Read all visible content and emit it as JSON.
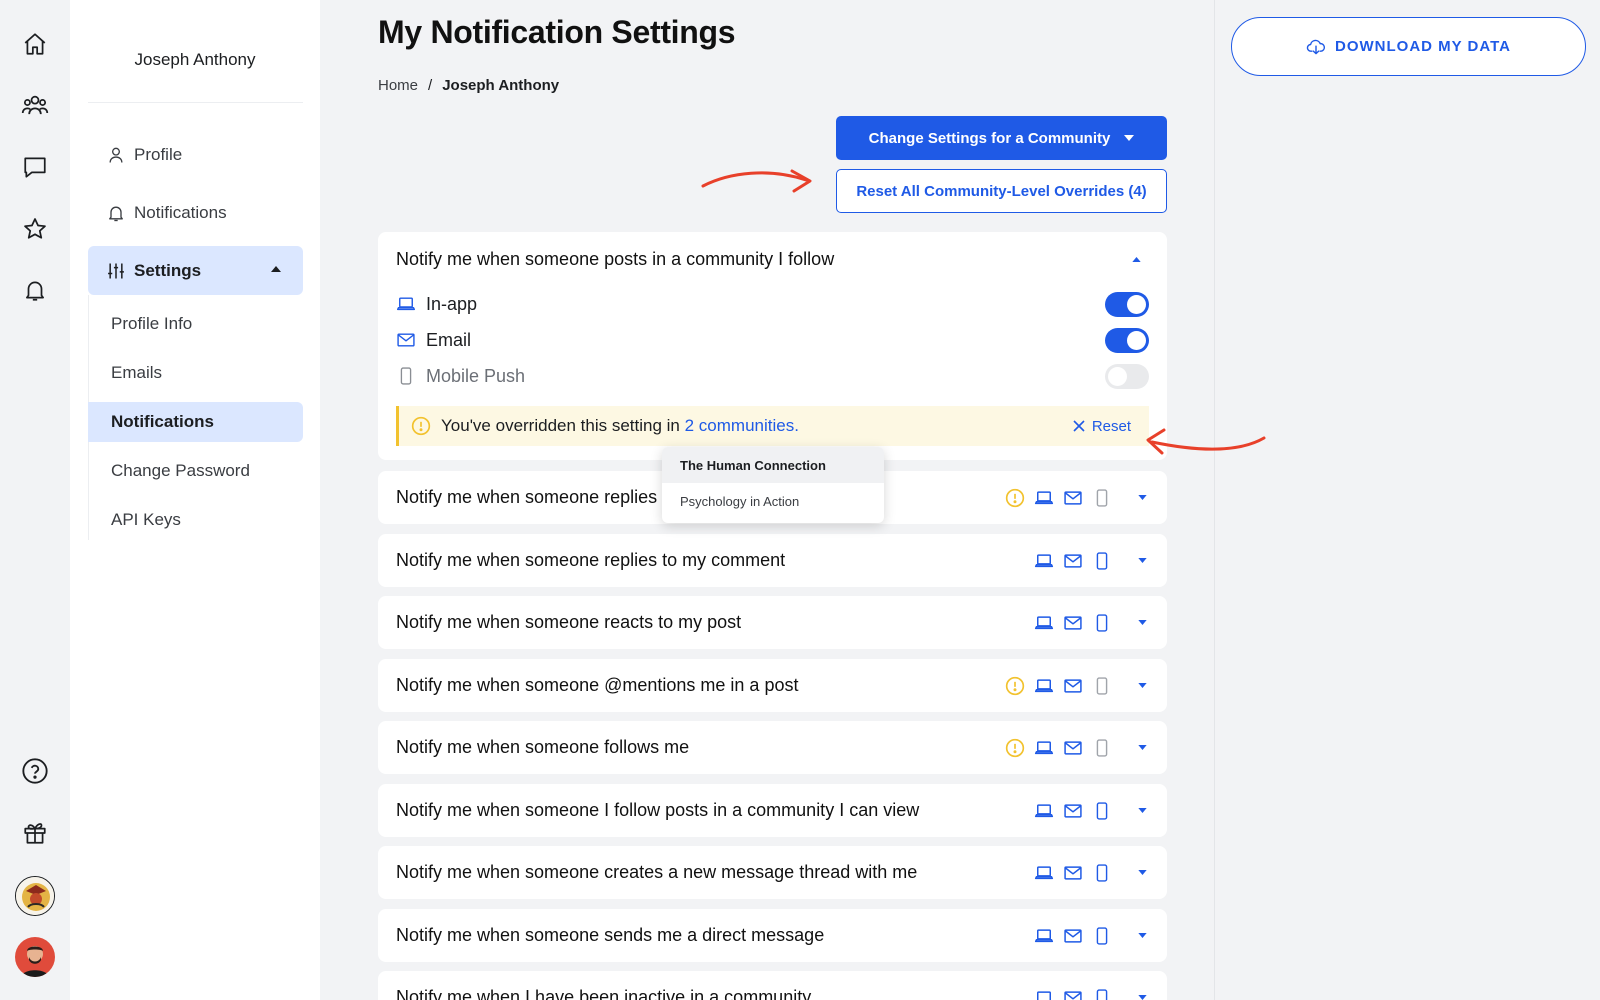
{
  "user": {
    "name": "Joseph Anthony"
  },
  "nav": {
    "profile": "Profile",
    "notifications": "Notifications",
    "settings": "Settings",
    "sub": [
      "Profile Info",
      "Emails",
      "Notifications",
      "Change Password",
      "API Keys"
    ]
  },
  "page": {
    "title": "My Notification Settings"
  },
  "breadcrumb": {
    "home": "Home",
    "separator": "/",
    "current": "Joseph Anthony"
  },
  "actions": {
    "change_settings": "Change Settings for a Community",
    "reset_overrides": "Reset All Community-Level Overrides (4)"
  },
  "expanded": {
    "title": "Notify me when someone posts in a community I follow",
    "channels": [
      {
        "label": "In-app",
        "enabled": true
      },
      {
        "label": "Email",
        "enabled": true
      },
      {
        "label": "Mobile Push",
        "enabled": false
      }
    ],
    "override_text": "You've overridden this setting in",
    "override_link": "2 communities.",
    "reset_label": "Reset"
  },
  "popover": {
    "items": [
      "The Human Connection",
      "Psychology in Action"
    ]
  },
  "rows": [
    {
      "label": "Notify me when someone replies to my post",
      "warning": true,
      "inapp": true,
      "email": true,
      "push": false
    },
    {
      "label": "Notify me when someone replies to my comment",
      "warning": false,
      "inapp": true,
      "email": true,
      "push": true
    },
    {
      "label": "Notify me when someone reacts to my post",
      "warning": false,
      "inapp": true,
      "email": true,
      "push": true
    },
    {
      "label": "Notify me when someone @mentions me in a post",
      "warning": true,
      "inapp": true,
      "email": true,
      "push": false
    },
    {
      "label": "Notify me when someone follows me",
      "warning": true,
      "inapp": true,
      "email": true,
      "push": false
    },
    {
      "label": "Notify me when someone I follow posts in a community I can view",
      "warning": false,
      "inapp": true,
      "email": true,
      "push": true
    },
    {
      "label": "Notify me when someone creates a new message thread with me",
      "warning": false,
      "inapp": true,
      "email": true,
      "push": true
    },
    {
      "label": "Notify me when someone sends me a direct message",
      "warning": false,
      "inapp": true,
      "email": true,
      "push": true
    },
    {
      "label": "Notify me when I have been inactive in a community",
      "warning": false,
      "inapp": true,
      "email": true,
      "push": true
    }
  ],
  "download": {
    "label": "DOWNLOAD MY DATA"
  },
  "colors": {
    "accent": "#1f5ae6",
    "warning": "#f2c22e",
    "active_bg": "#dbe7ff",
    "annotation": "#e8402a"
  }
}
